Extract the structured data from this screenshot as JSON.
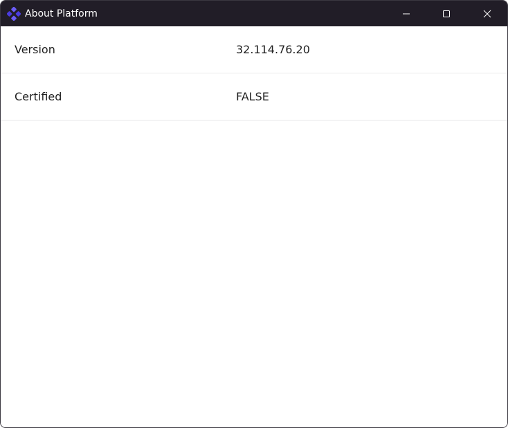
{
  "window": {
    "title": "About Platform",
    "app_icon": "platform-logo-icon",
    "controls": {
      "minimize_icon": "minimize-icon",
      "maximize_icon": "maximize-icon",
      "close_icon": "close-icon"
    }
  },
  "properties": [
    {
      "label": "Version",
      "value": "32.114.76.20"
    },
    {
      "label": "Certified",
      "value": "FALSE"
    }
  ],
  "colors": {
    "titlebar_bg": "#211d27",
    "accent": "#5b4cf5",
    "text": "#1f1f1f",
    "divider": "#e9e9ea"
  }
}
